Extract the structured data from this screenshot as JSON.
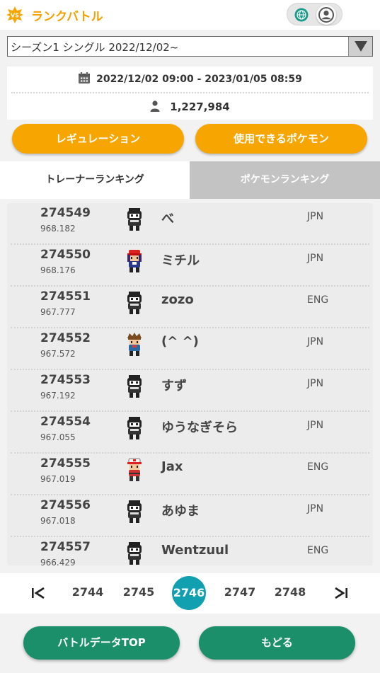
{
  "header": {
    "title": "ランクバトル",
    "accent_color": "#f2a200"
  },
  "season_select": {
    "value": "シーズン1 シングル 2022/12/02~"
  },
  "info": {
    "period": "2022/12/02 09:00 - 2023/01/05 08:59",
    "players": "1,227,984"
  },
  "buttons": {
    "regulation": "レギュレーション",
    "usable_pokemon": "使用できるポケモン",
    "battle_data_top": "バトルデータTOP",
    "back": "もどる"
  },
  "tabs": [
    {
      "label": "トレーナーランキング",
      "active": true
    },
    {
      "label": "ポケモンランキング",
      "active": false
    }
  ],
  "rankings": [
    {
      "rank": "274549",
      "rating": "968.182",
      "name": "べ",
      "country": "JPN",
      "avatar": "trainer-masked"
    },
    {
      "rank": "274550",
      "rating": "968.176",
      "name": "ミチル",
      "country": "JPN",
      "avatar": "trainer-cap"
    },
    {
      "rank": "274551",
      "rating": "967.777",
      "name": "zozo",
      "country": "ENG",
      "avatar": "trainer-masked"
    },
    {
      "rank": "274552",
      "rating": "967.572",
      "name": "(^ ^)",
      "country": "JPN",
      "avatar": "trainer-spiky"
    },
    {
      "rank": "274553",
      "rating": "967.192",
      "name": "すず",
      "country": "JPN",
      "avatar": "trainer-masked"
    },
    {
      "rank": "274554",
      "rating": "967.055",
      "name": "ゆうなぎそら",
      "country": "JPN",
      "avatar": "trainer-masked"
    },
    {
      "rank": "274555",
      "rating": "967.019",
      "name": "Jax",
      "country": "ENG",
      "avatar": "trainer-white-cap"
    },
    {
      "rank": "274556",
      "rating": "967.018",
      "name": "あゆま",
      "country": "JPN",
      "avatar": "trainer-masked"
    },
    {
      "rank": "274557",
      "rating": "966.429",
      "name": "Wentzuul",
      "country": "ENG",
      "avatar": "trainer-masked"
    }
  ],
  "pagination": {
    "pages": [
      "2744",
      "2745",
      "2746",
      "2747",
      "2748"
    ],
    "current": "2746",
    "current_color": "#11a0b0"
  }
}
